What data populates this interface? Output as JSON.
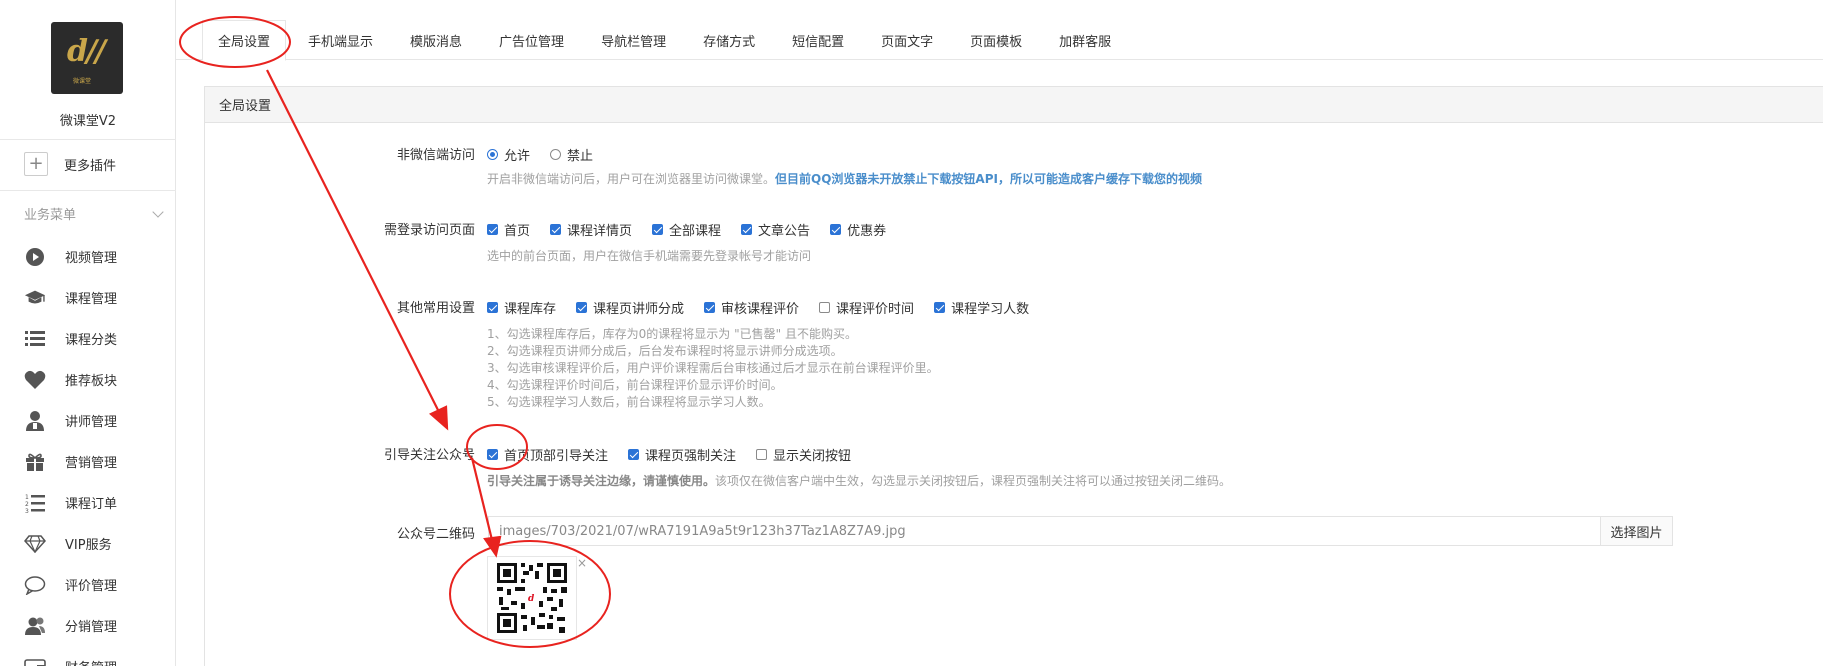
{
  "sidebar": {
    "logo_text": "微课堂",
    "site_name": "微课堂V2",
    "more_plugins": "更多插件",
    "menu_header": "业务菜单",
    "items": [
      {
        "label": "视频管理",
        "icon": "play-icon"
      },
      {
        "label": "课程管理",
        "icon": "graduation-cap-icon"
      },
      {
        "label": "课程分类",
        "icon": "list-icon"
      },
      {
        "label": "推荐板块",
        "icon": "heart-icon"
      },
      {
        "label": "讲师管理",
        "icon": "teacher-icon"
      },
      {
        "label": "营销管理",
        "icon": "gift-icon"
      },
      {
        "label": "课程订单",
        "icon": "ordered-list-icon"
      },
      {
        "label": "VIP服务",
        "icon": "diamond-icon"
      },
      {
        "label": "评价管理",
        "icon": "comment-icon"
      },
      {
        "label": "分销管理",
        "icon": "users-icon"
      },
      {
        "label": "财务管理",
        "icon": "wallet-icon"
      }
    ]
  },
  "tabs": [
    "全局设置",
    "手机端显示",
    "模版消息",
    "广告位管理",
    "导航栏管理",
    "存储方式",
    "短信配置",
    "页面文字",
    "页面模板",
    "加群客服"
  ],
  "panel": {
    "title": "全局设置",
    "rows": {
      "nonwechat": {
        "label": "非微信端访问",
        "options": [
          {
            "label": "允许",
            "checked": true
          },
          {
            "label": "禁止",
            "checked": false
          }
        ],
        "help_plain": "开启非微信端访问后，用户可在浏览器里访问微课堂。",
        "help_bold": "但目前QQ浏览器未开放禁止下载按钮API，所以可能造成客户缓存下载您的视频"
      },
      "login_pages": {
        "label": "需登录访问页面",
        "options": [
          {
            "label": "首页",
            "checked": true
          },
          {
            "label": "课程详情页",
            "checked": true
          },
          {
            "label": "全部课程",
            "checked": true
          },
          {
            "label": "文章公告",
            "checked": true
          },
          {
            "label": "优惠券",
            "checked": true
          }
        ],
        "help": "选中的前台页面，用户在微信手机端需要先登录帐号才能访问"
      },
      "common": {
        "label": "其他常用设置",
        "options": [
          {
            "label": "课程库存",
            "checked": true
          },
          {
            "label": "课程页讲师分成",
            "checked": true
          },
          {
            "label": "审核课程评价",
            "checked": true
          },
          {
            "label": "课程评价时间",
            "checked": false
          },
          {
            "label": "课程学习人数",
            "checked": true
          }
        ],
        "notes": [
          "1、勾选课程库存后，库存为0的课程将显示为 \"已售罄\" 且不能购买。",
          "2、勾选课程页讲师分成后，后台发布课程时将显示讲师分成选项。",
          "3、勾选审核课程评价后，用户评价课程需后台审核通过后才显示在前台课程评价里。",
          "4、勾选课程评价时间后，前台课程评价显示评价时间。",
          "5、勾选课程学习人数后，前台课程将显示学习人数。"
        ]
      },
      "follow": {
        "label": "引导关注公众号",
        "options": [
          {
            "label": "首页顶部引导关注",
            "checked": true
          },
          {
            "label": "课程页强制关注",
            "checked": true
          },
          {
            "label": "显示关闭按钮",
            "checked": false
          }
        ],
        "help_bold": "引导关注属于诱导关注边缘，请谨慎使用。",
        "help_plain": "该项仅在微信客户端中生效，勾选显示关闭按钮后，课程页强制关注将可以通过按钮关闭二维码。"
      },
      "qrcode": {
        "label": "公众号二维码",
        "value": "images/703/2021/07/wRA7191A9a5t9r123h37Taz1A8Z7A9.jpg",
        "button": "选择图片",
        "close": "×"
      }
    }
  },
  "colors": {
    "accent": "#2b73d6",
    "annotation": "#e8231f",
    "link_help": "#4a8ecb"
  }
}
